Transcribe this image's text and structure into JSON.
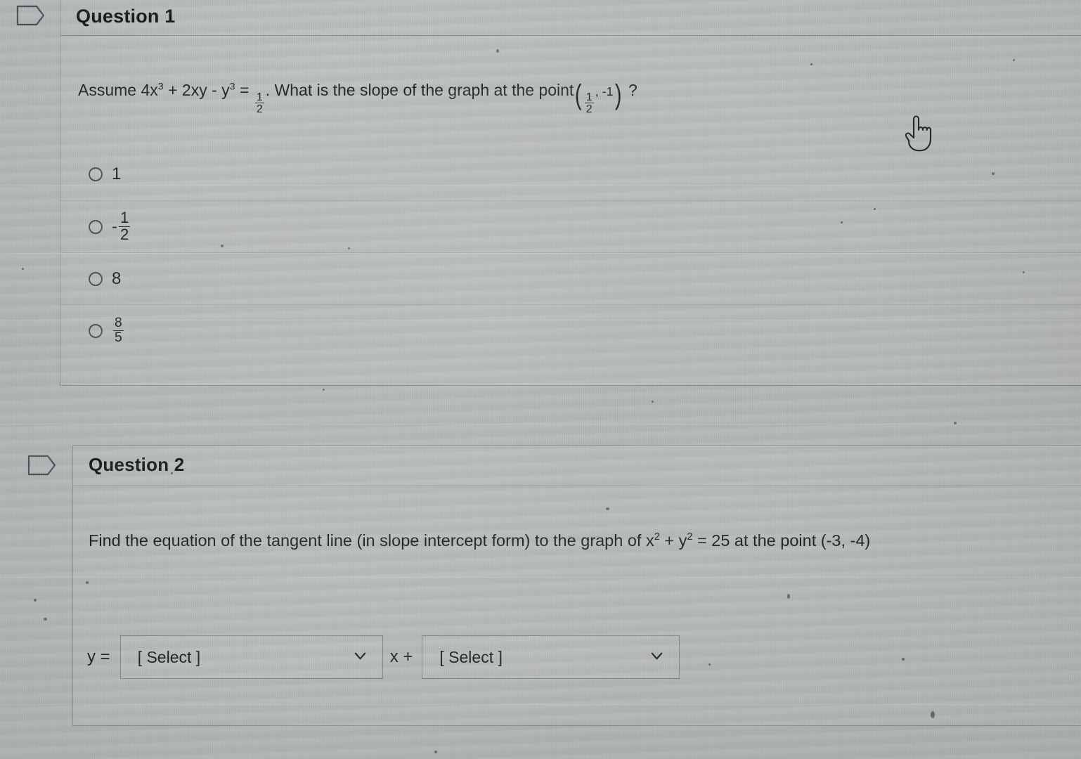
{
  "colors": {
    "screen_background": "#b7bbbb",
    "card_border": "#5a6064",
    "text": "#1e2123",
    "radio_border": "#4d5356"
  },
  "questions": [
    {
      "header_label": "Question 1",
      "flag_icon": "bookmark-flag-icon",
      "stem": {
        "lead": "Assume 4x",
        "exp1": "3",
        "mid": " + 2xy - y",
        "exp2": "3",
        "eq": " = ",
        "frac_num": "1",
        "frac_den": "2",
        "tail": ". What is the slope of the graph at the point",
        "point_num": "1",
        "point_den": "2",
        "point_y": ", -1",
        "question_mark": "?"
      },
      "options": [
        {
          "id": "option-1",
          "text": "1",
          "type": "plain",
          "selected": false
        },
        {
          "id": "option-2",
          "text": "-",
          "type": "fraction",
          "num": "1",
          "den": "2",
          "selected": false
        },
        {
          "id": "option-3",
          "text": "8",
          "type": "plain",
          "selected": false
        },
        {
          "id": "option-4",
          "text": "",
          "type": "fraction",
          "num": "8",
          "den": "5",
          "selected": false
        }
      ]
    },
    {
      "header_label": "Question 2",
      "flag_icon": "bookmark-flag-icon",
      "stem": {
        "lead": "Find the equation of the tangent line (in slope intercept form) to the graph of x",
        "exp1": "2",
        "mid": " + y",
        "exp2": "2",
        "tail": " = 25 at the point (-3, -4)"
      },
      "answer": {
        "prefix_label": "y =",
        "slope_select_value": "[ Select ]",
        "middle_operator": "x +",
        "intercept_select_value": "[ Select ]",
        "chevron_icon": "chevron-down-icon"
      }
    }
  ],
  "cursor": {
    "icon": "pointer-hand-cursor-icon"
  }
}
